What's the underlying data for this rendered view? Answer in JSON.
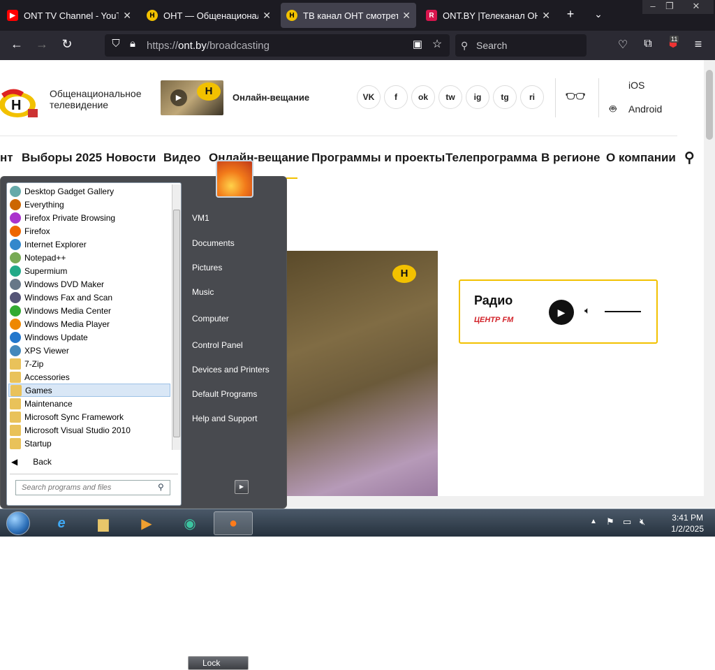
{
  "browser": {
    "tabs": [
      {
        "title": "ONT TV Channel - YouTube",
        "active": false,
        "icon": "youtube-icon"
      },
      {
        "title": "ОНТ — Общенациональное",
        "active": false,
        "icon": "ont-icon"
      },
      {
        "title": "ТВ канал ОНТ смотреть | ОНТ",
        "active": true,
        "icon": "ont-icon"
      },
      {
        "title": "ONT.BY |Телеканал ОНТ в",
        "active": false,
        "icon": "ontby-icon"
      }
    ],
    "url_prefix": "https://",
    "url_host": "ont.by",
    "url_path": "/broadcasting",
    "search_placeholder": "Search",
    "extension_badge": "11"
  },
  "site": {
    "brand_line1": "Общенациональное",
    "brand_line2": "телевидение",
    "live_label": "Онлайн-вещание",
    "social": [
      "VK",
      "f",
      "ok",
      "tw",
      "ig",
      "tg",
      "ri"
    ],
    "app_ios": "iOS",
    "app_android": "Android",
    "menu": [
      "нт",
      "Выборы 2025",
      "Новости",
      "Видео",
      "Онлайн-вещание",
      "Программы и проекты",
      "Телепрограмма",
      "В регионе",
      "О компании"
    ],
    "radio_title": "Радио",
    "radio_station": "ЦЕНТР FM"
  },
  "startmenu": {
    "programs": [
      "Desktop Gadget Gallery",
      "Everything",
      "Firefox Private Browsing",
      "Firefox",
      "Internet Explorer",
      "Notepad++",
      "Supermium",
      "Windows DVD Maker",
      "Windows Fax and Scan",
      "Windows Media Center",
      "Windows Media Player",
      "Windows Update",
      "XPS Viewer",
      "7-Zip",
      "Accessories",
      "Games",
      "Maintenance",
      "Microsoft Sync Framework",
      "Microsoft Visual Studio 2010",
      "Startup"
    ],
    "selected": "Games",
    "back": "Back",
    "search_placeholder": "Search programs and files",
    "right": [
      "VM1",
      "Documents",
      "Pictures",
      "Music",
      "Computer",
      "Control Panel",
      "Devices and Printers",
      "Default Programs",
      "Help and Support"
    ],
    "lock": "Lock"
  },
  "taskbar": {
    "time": "3:41 PM",
    "date": "1/2/2025"
  }
}
